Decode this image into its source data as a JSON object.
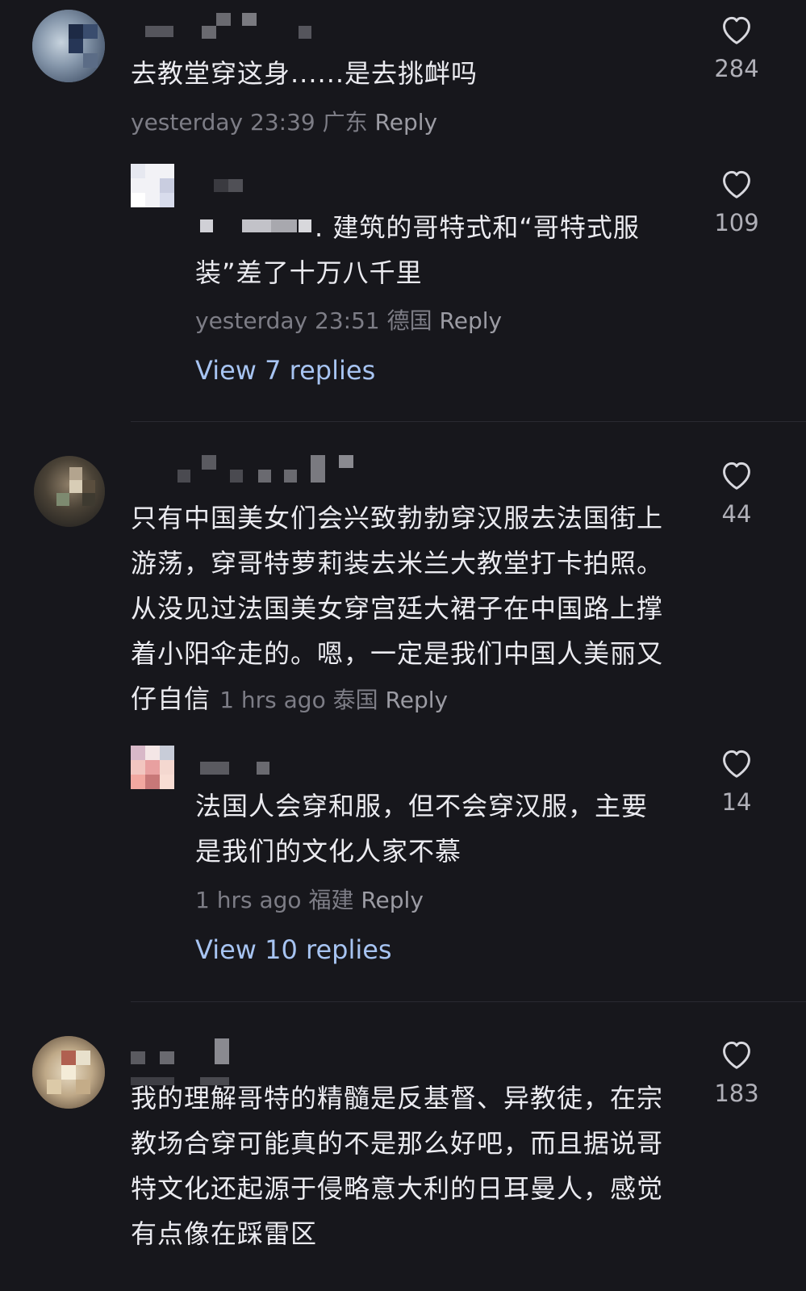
{
  "comments": [
    {
      "text": "去教堂穿这身......是去挑衅吗",
      "time": "yesterday 23:39",
      "location": "广东",
      "reply_label": "Reply",
      "likes": "284"
    },
    {
      "text": ". 建筑的哥特式和“哥特式服装”差了十万八千里",
      "time": "yesterday 23:51",
      "location": "德国",
      "reply_label": "Reply",
      "likes": "109",
      "view_replies": "View 7 replies"
    },
    {
      "text": "只有中国美女们会兴致勃勃穿汉服去法国街上游荡，穿哥特萝莉装去米兰大教堂打卡拍照。从没见过法国美女穿宫廷大裙子在中国路上撑着小阳伞走的。嗯，一定是我们中国人美丽又仔自信",
      "time": "1 hrs ago",
      "location": "泰国",
      "reply_label": "Reply",
      "likes": "44"
    },
    {
      "text": "法国人会穿和服，但不会穿汉服，主要是我们的文化人家不慕",
      "time": "1 hrs ago",
      "location": "福建",
      "reply_label": "Reply",
      "likes": "14",
      "view_replies": "View 10 replies"
    },
    {
      "text": "我的理解哥特的精髓是反基督、异教徒，在宗教场合穿可能真的不是那么好吧，而且据说哥特文化还起源于侵略意大利的日耳曼人，感觉有点像在踩雷区",
      "likes": "183"
    }
  ],
  "icons": {
    "like": "heart-outline-icon"
  },
  "colors": {
    "background": "#17171c",
    "link": "#a7c4f2",
    "meta": "#7d7d86"
  }
}
